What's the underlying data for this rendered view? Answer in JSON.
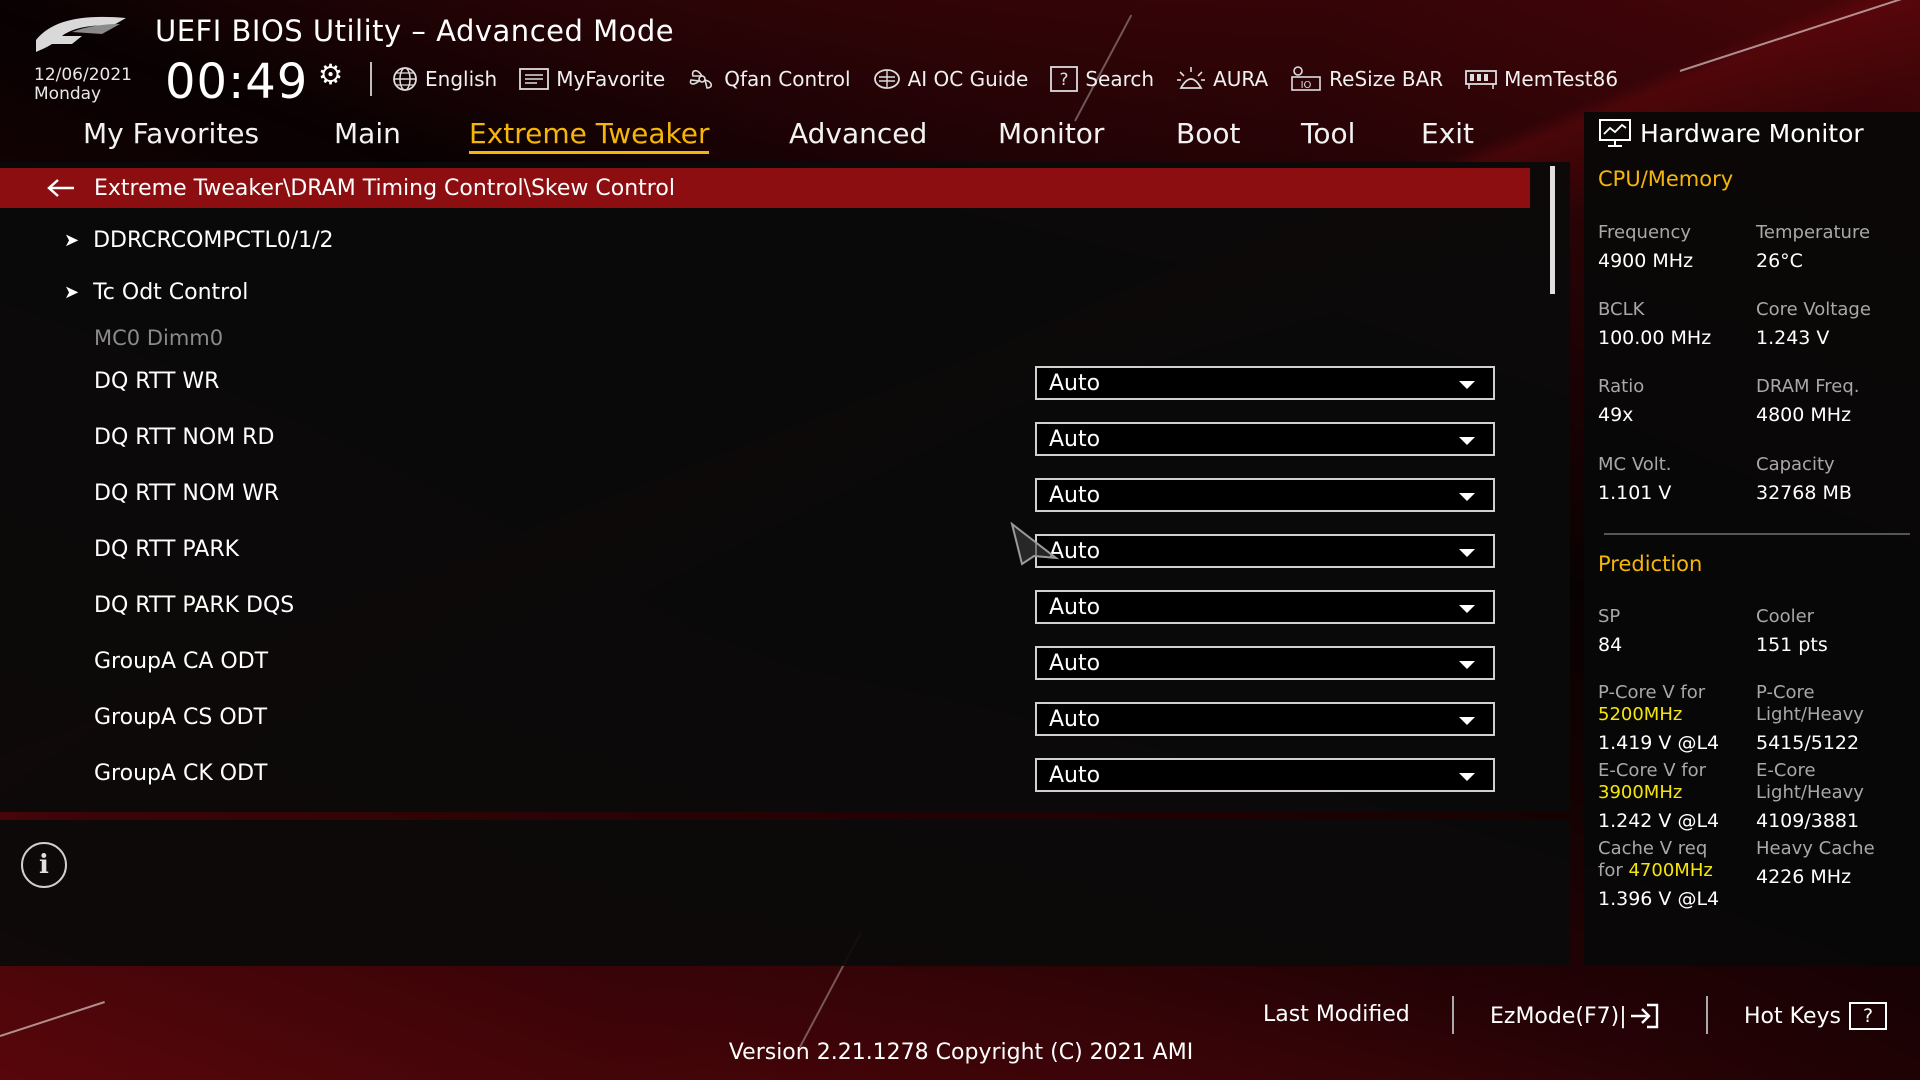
{
  "header": {
    "title": "UEFI BIOS Utility – Advanced Mode",
    "date": "12/06/2021",
    "day": "Monday",
    "time": "00:49"
  },
  "toolbar": [
    {
      "label": "English",
      "icon": "globe-icon"
    },
    {
      "label": "MyFavorite",
      "icon": "favorite-list-icon"
    },
    {
      "label": "Qfan Control",
      "icon": "fan-icon"
    },
    {
      "label": "AI OC Guide",
      "icon": "ai-chip-icon"
    },
    {
      "label": "Search",
      "icon": "question-box-icon"
    },
    {
      "label": "AURA",
      "icon": "aura-light-icon"
    },
    {
      "label": "ReSize BAR",
      "icon": "resize-bar-icon"
    },
    {
      "label": "MemTest86",
      "icon": "memory-icon"
    }
  ],
  "menu": [
    {
      "label": "My Favorites",
      "active": false
    },
    {
      "label": "Main",
      "active": false
    },
    {
      "label": "Extreme Tweaker",
      "active": true
    },
    {
      "label": "Advanced",
      "active": false
    },
    {
      "label": "Monitor",
      "active": false
    },
    {
      "label": "Boot",
      "active": false
    },
    {
      "label": "Tool",
      "active": false
    },
    {
      "label": "Exit",
      "active": false
    }
  ],
  "breadcrumb": "Extreme Tweaker\\DRAM Timing Control\\Skew Control",
  "submenus": [
    "DDRCRCOMPCTL0/1/2",
    "Tc Odt Control"
  ],
  "section_label": "MC0 Dimm0",
  "settings": [
    {
      "label": "DQ RTT WR",
      "value": "Auto"
    },
    {
      "label": "DQ RTT NOM RD",
      "value": "Auto"
    },
    {
      "label": "DQ RTT NOM WR",
      "value": "Auto"
    },
    {
      "label": "DQ RTT PARK",
      "value": "Auto"
    },
    {
      "label": "DQ RTT PARK DQS",
      "value": "Auto"
    },
    {
      "label": "GroupA CA ODT",
      "value": "Auto"
    },
    {
      "label": "GroupA CS ODT",
      "value": "Auto"
    },
    {
      "label": "GroupA CK ODT",
      "value": "Auto"
    }
  ],
  "hw_monitor": {
    "title": "Hardware Monitor",
    "cpu_memory": {
      "heading": "CPU/Memory",
      "items": [
        {
          "label": "Frequency",
          "value": "4900 MHz"
        },
        {
          "label": "Temperature",
          "value": "26°C"
        },
        {
          "label": "BCLK",
          "value": "100.00 MHz"
        },
        {
          "label": "Core Voltage",
          "value": "1.243 V"
        },
        {
          "label": "Ratio",
          "value": "49x"
        },
        {
          "label": "DRAM Freq.",
          "value": "4800 MHz"
        },
        {
          "label": "MC Volt.",
          "value": "1.101 V"
        },
        {
          "label": "Capacity",
          "value": "32768 MB"
        }
      ]
    },
    "prediction": {
      "heading": "Prediction",
      "sp_label": "SP",
      "sp_value": "84",
      "cooler_label": "Cooler",
      "cooler_value": "151 pts",
      "pcore_v_label": "P-Core V for",
      "pcore_v_freq": "5200MHz",
      "pcore_v_value": "1.419 V @L4",
      "pcore_lh_label_1": "P-Core",
      "pcore_lh_label_2": "Light/Heavy",
      "pcore_lh_value": "5415/5122",
      "ecore_v_label": "E-Core V for",
      "ecore_v_freq": "3900MHz",
      "ecore_v_value": "1.242 V @L4",
      "ecore_lh_label_1": "E-Core",
      "ecore_lh_label_2": "Light/Heavy",
      "ecore_lh_value": "4109/3881",
      "cache_v_label_1": "Cache V req",
      "cache_v_label_2": "for",
      "cache_v_freq": "4700MHz",
      "cache_v_value": "1.396 V @L4",
      "heavy_cache_label": "Heavy Cache",
      "heavy_cache_value": "4226 MHz"
    }
  },
  "footer": {
    "last_modified": "Last Modified",
    "ezmode": "EzMode(F7)|",
    "hotkeys": "Hot Keys",
    "hotkeys_key": "?",
    "version": "Version 2.21.1278 Copyright (C) 2021 AMI"
  },
  "colors": {
    "accent": "#f5b50a",
    "breadcrumb_bg": "#8c0e10",
    "prediction_highlight": "#f5e60a"
  }
}
